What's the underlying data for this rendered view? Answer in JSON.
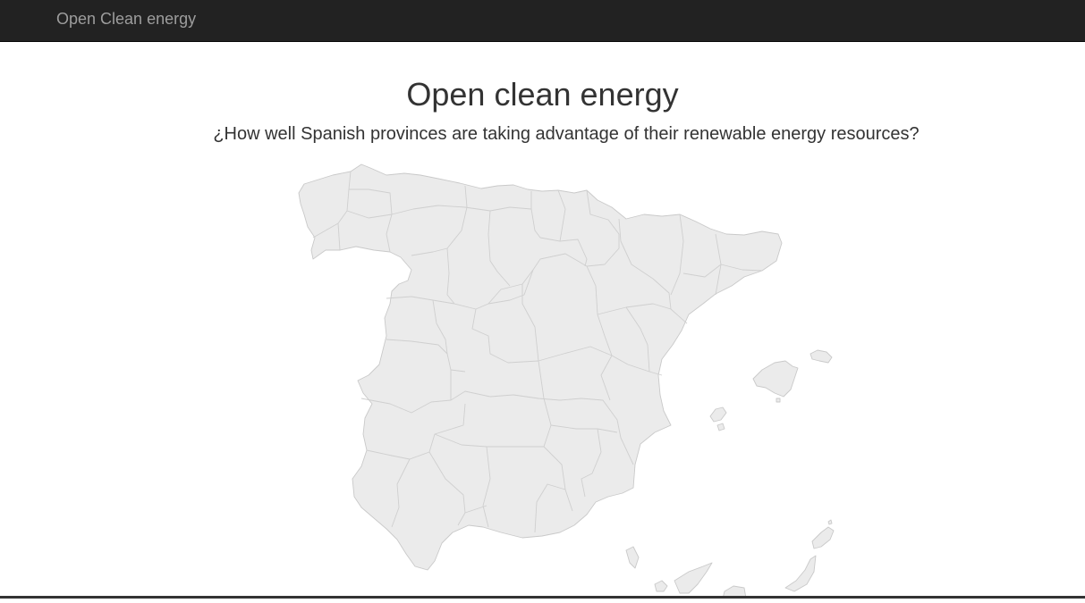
{
  "navbar": {
    "brand": "Open Clean energy"
  },
  "header": {
    "title": "Open clean energy",
    "subtitle": "¿How well Spanish provinces are taking advantage of their renewable energy resources?"
  },
  "map": {
    "region": "Spain provinces",
    "fill_color": "#ebebeb",
    "border_color": "#c9c9c9"
  },
  "colors": {
    "navbar_bg": "#222222",
    "navbar_text": "#9d9d9d",
    "text": "#333333"
  }
}
